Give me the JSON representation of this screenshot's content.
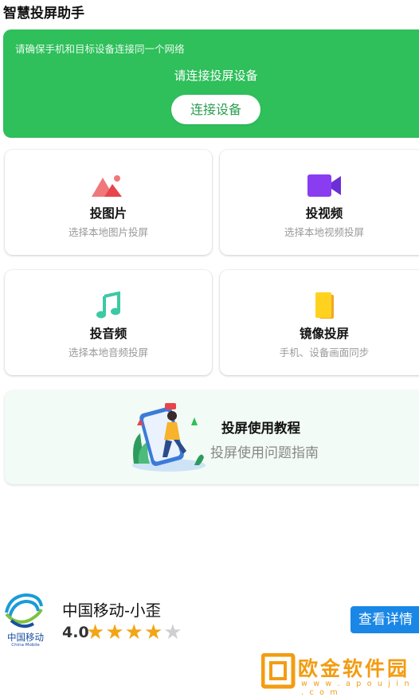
{
  "app": {
    "title": "智慧投屏助手"
  },
  "banner": {
    "hint": "请确保手机和目标设备连接同一个网络",
    "status": "请连接投屏设备",
    "connect_label": "连接设备",
    "color": "#2fbf5b"
  },
  "cards": [
    {
      "title": "投图片",
      "subtitle": "选择本地图片投屏",
      "icon": "image-icon"
    },
    {
      "title": "投视频",
      "subtitle": "选择本地视频投屏",
      "icon": "video-camera-icon"
    },
    {
      "title": "投音频",
      "subtitle": "选择本地音频投屏",
      "icon": "music-note-icon"
    },
    {
      "title": "镜像投屏",
      "subtitle": "手机、设备画面同步",
      "icon": "mirror-icon"
    }
  ],
  "tutorial": {
    "title": "投屏使用教程",
    "subtitle": "投屏使用问题指南"
  },
  "ad": {
    "logo_cn": "中国移动",
    "logo_en": "China Mobile",
    "name": "中国移动-小歪",
    "rating": "4.0",
    "stars": 4,
    "max_stars": 5,
    "detail_label": "查看详情"
  },
  "watermark": {
    "text": "欧金软件园",
    "url": "w w w . a p o u j i n . c o m"
  }
}
